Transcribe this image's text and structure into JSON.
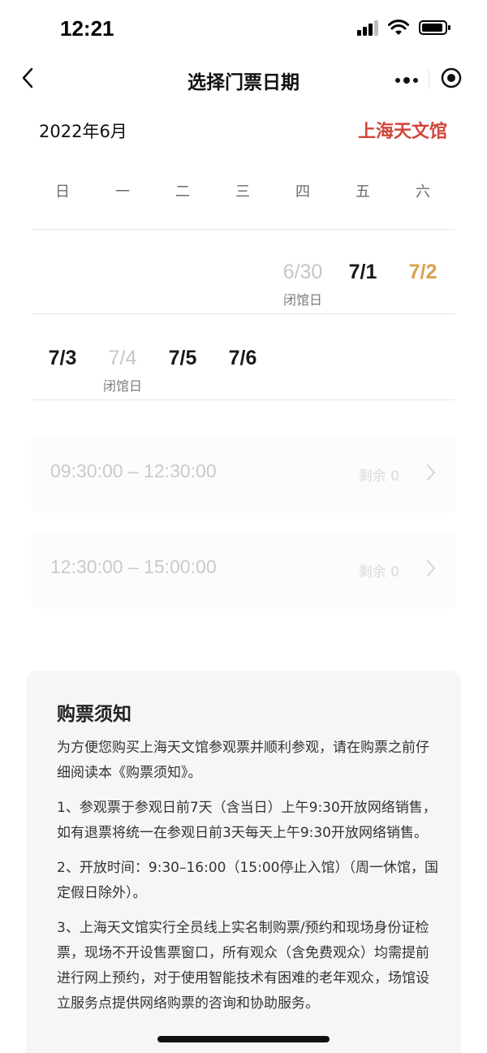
{
  "status_bar": {
    "time": "12:21"
  },
  "nav": {
    "title": "选择门票日期"
  },
  "calendar": {
    "month": "2022年6月",
    "venue": "上海天文馆",
    "weekdays": [
      "日",
      "一",
      "二",
      "三",
      "四",
      "五",
      "六"
    ],
    "week1": [
      {
        "date": "6/30",
        "note": "闭馆日",
        "state": "closed"
      },
      {
        "date": "7/1",
        "state": "normal"
      },
      {
        "date": "7/2",
        "state": "selected"
      }
    ],
    "week2": [
      {
        "date": "7/3",
        "state": "normal"
      },
      {
        "date": "7/4",
        "note": "闭馆日",
        "state": "closed"
      },
      {
        "date": "7/5",
        "state": "normal"
      },
      {
        "date": "7/6",
        "state": "normal"
      }
    ]
  },
  "slots": [
    {
      "time": "09:30:00 – 12:30:00",
      "remaining": "剩余 0"
    },
    {
      "time": "12:30:00 – 15:00:00",
      "remaining": "剩余 0"
    }
  ],
  "notice": {
    "title": "购票须知",
    "paragraphs": [
      "为方便您购买上海天文馆参观票并顺利参观，请在购票之前仔细阅读本《购票须知》。",
      "1、参观票于参观日前7天（含当日）上午9:30开放网络销售，如有退票将统一在参观日前3天每天上午9:30开放网络销售。",
      "2、开放时间：9:30–16:00（15:00停止入馆）（周一休馆，国定假日除外）。",
      "3、上海天文馆实行全员线上实名制购票/预约和现场身份证检票，现场不开设售票窗口，所有观众（含免费观众）均需提前进行网上预约，对于使用智能技术有困难的老年观众，场馆设立服务点提供网络购票的咨询和协助服务。"
    ]
  },
  "colors": {
    "accent_red": "#d2453a",
    "accent_gold": "#d9a14a"
  },
  "icons": {
    "back": "chevron-left-icon",
    "more": "more-dots-icon",
    "close": "target-close-icon",
    "slot_arrow": "chevron-right-icon"
  }
}
